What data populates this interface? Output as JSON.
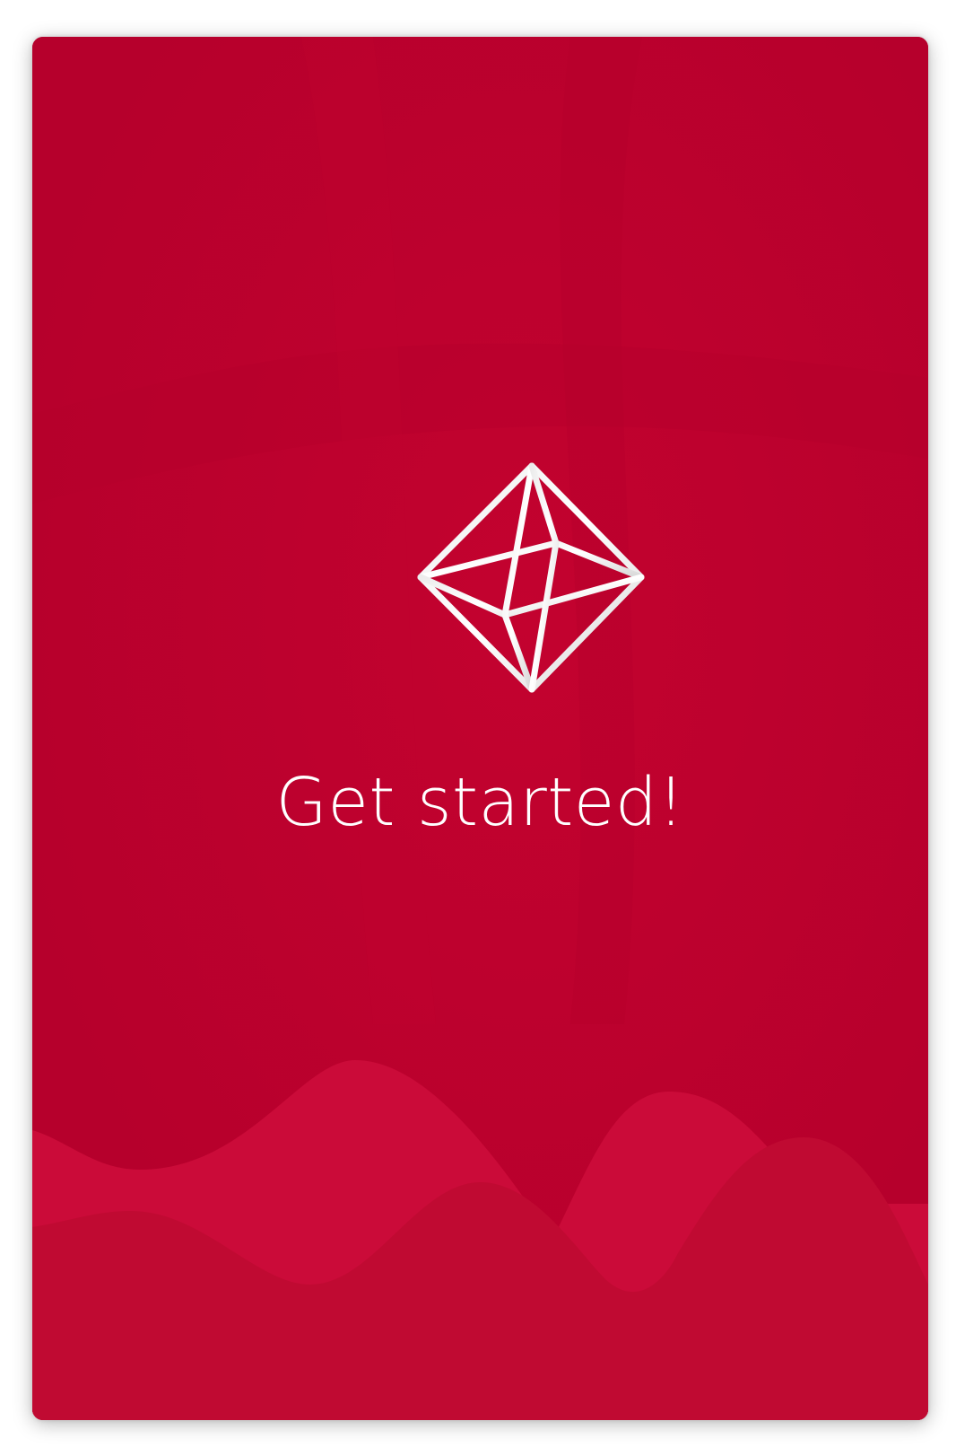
{
  "onboarding": {
    "title": "Get started!"
  },
  "logo": {
    "icon": "octahedron-icon"
  },
  "colors": {
    "background": "#bb002e",
    "wave_light": "#cb0b39",
    "wave_mid": "#c00a32",
    "text": "#ffffff"
  }
}
